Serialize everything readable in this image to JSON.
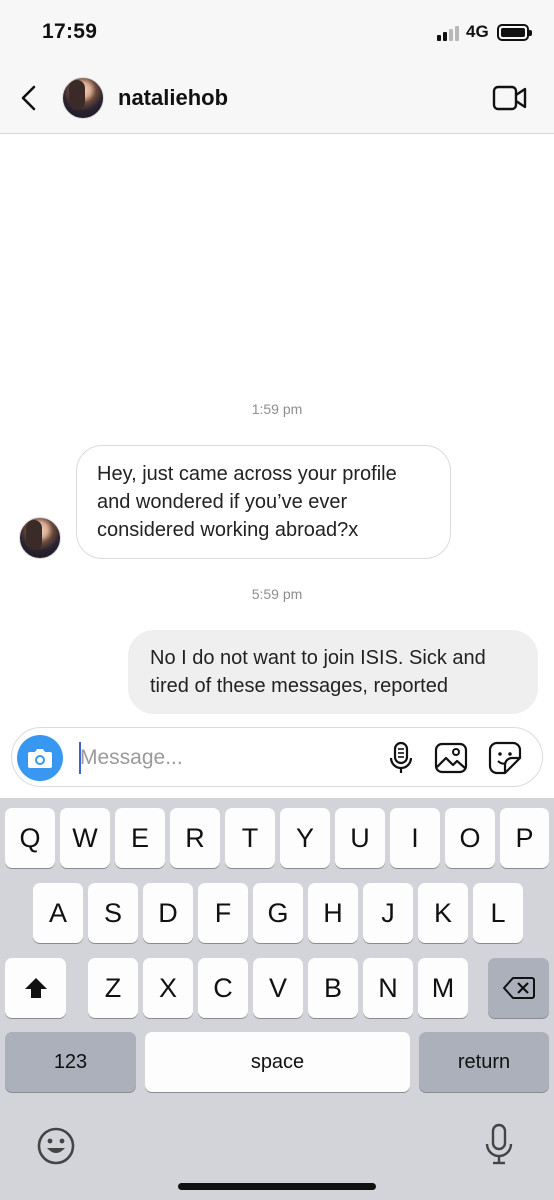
{
  "status_bar": {
    "time": "17:59",
    "network": "4G"
  },
  "header": {
    "username": "nataliehob"
  },
  "messages": [
    {
      "timestamp": "1:59 pm",
      "direction": "incoming",
      "text": "Hey, just came across your profile and wondered if you’ve ever considered working abroad?x"
    },
    {
      "timestamp": "5:59 pm",
      "direction": "outgoing",
      "text": "No I do not want to join ISIS. Sick and tired of these messages, reported"
    }
  ],
  "composer": {
    "placeholder": "Message..."
  },
  "keyboard": {
    "row1": [
      "Q",
      "W",
      "E",
      "R",
      "T",
      "Y",
      "U",
      "I",
      "O",
      "P"
    ],
    "row2": [
      "A",
      "S",
      "D",
      "F",
      "G",
      "H",
      "J",
      "K",
      "L"
    ],
    "row3": [
      "Z",
      "X",
      "C",
      "V",
      "B",
      "N",
      "M"
    ],
    "numbers_label": "123",
    "space_label": "space",
    "return_label": "return"
  },
  "colors": {
    "accent": "#3897f0",
    "outgoing_bubble": "#efefef",
    "keyboard_bg": "#d2d4d9"
  },
  "icons": [
    "chevron-left-icon",
    "video-camera-icon",
    "camera-icon",
    "microphone-icon",
    "image-icon",
    "sticker-icon",
    "shift-icon",
    "backspace-icon",
    "emoji-icon",
    "dictation-icon"
  ]
}
